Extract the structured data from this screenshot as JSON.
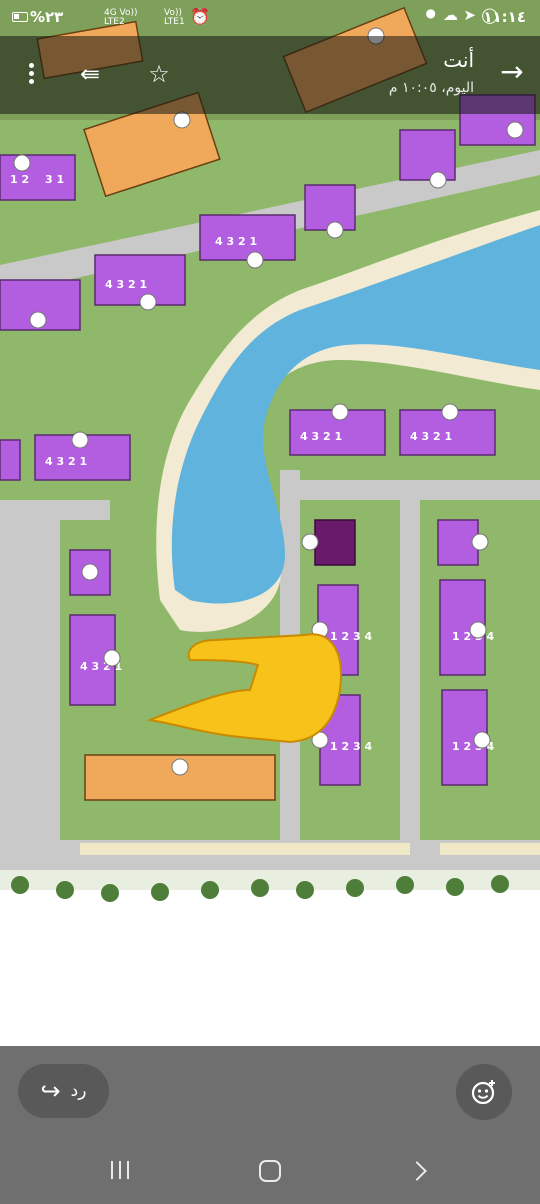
{
  "status_bar": {
    "time": "١١:١٤",
    "battery": "%٢٣",
    "network_1_top": "4G Vo))",
    "network_1_bottom": "LTE2",
    "network_2_top": "Vo))",
    "network_2_bottom": "LTE1",
    "icons": [
      "whatsapp-icon",
      "telegram-icon",
      "location-icon",
      "cloud-icon",
      "alarm-icon",
      "signal-icon"
    ]
  },
  "header": {
    "sender": "أنت",
    "timestamp": "اليوم، ١٠:٠٥ م",
    "icons": [
      "back-arrow-icon",
      "star-icon",
      "forward-icon",
      "more-vert-icon"
    ]
  },
  "map": {
    "description_labels": [
      "1",
      "2",
      "3",
      "4"
    ],
    "colors": {
      "grass": "#8fb86a",
      "water": "#5fb3dd",
      "building_purple": "#b35ee0",
      "building_orange": "#f0a85a",
      "building_dark": "#6a1a6a",
      "road": "#c9c9c9"
    }
  },
  "bottom": {
    "reply_label": "رد",
    "icons": [
      "reply-icon",
      "emoji-add-icon"
    ]
  },
  "nav": {
    "icons": [
      "recent-apps-icon",
      "home-icon",
      "back-chevron-icon"
    ]
  }
}
